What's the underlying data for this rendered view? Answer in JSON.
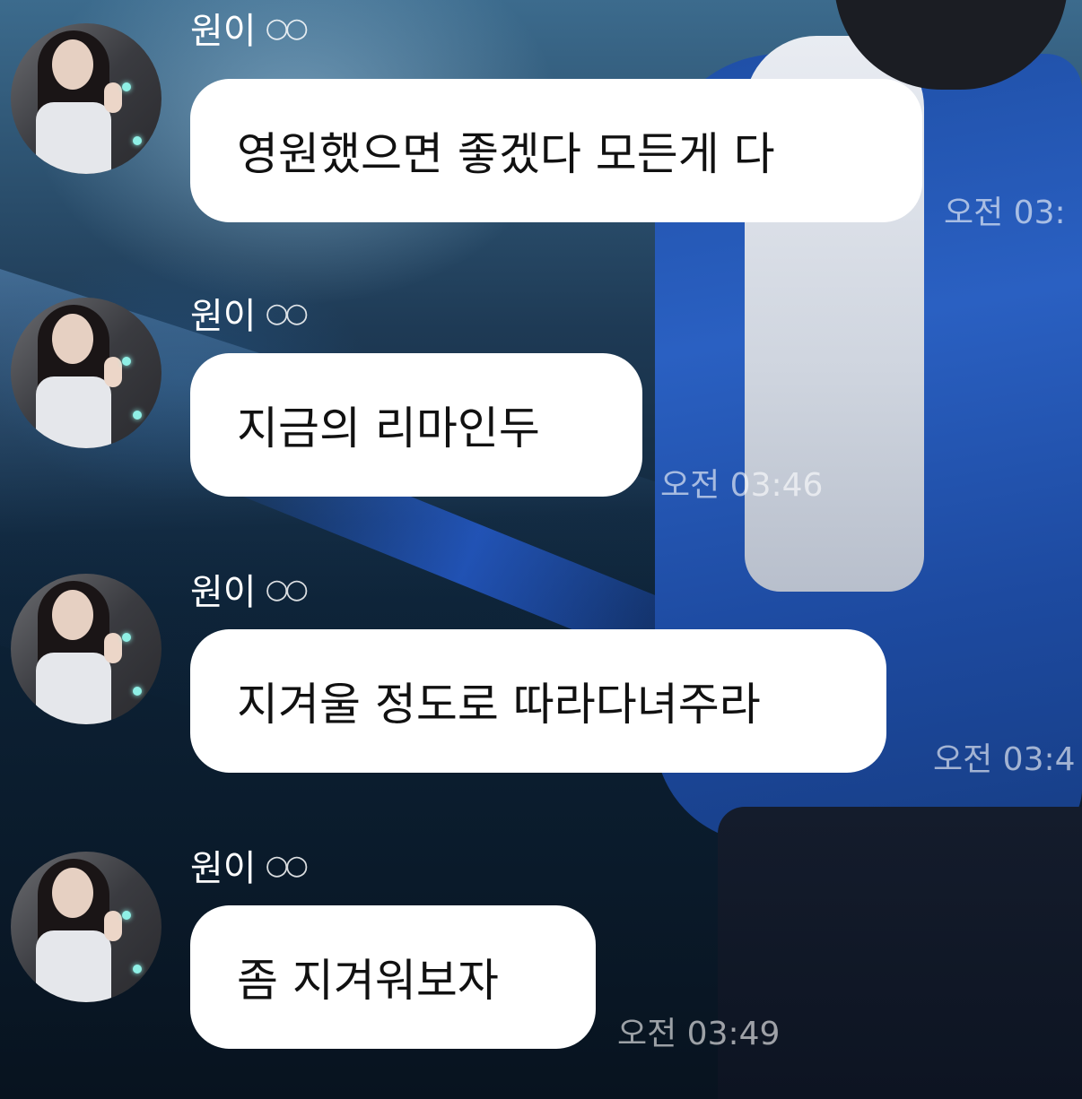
{
  "messages": [
    {
      "sender": "원이",
      "text": "영원했으면 좋겠다 모든게 다",
      "time": "오전 03:"
    },
    {
      "sender": "원이",
      "text": "지금의 리마인두",
      "time": "오전 03:46"
    },
    {
      "sender": "원이",
      "text": "지겨울 정도로 따라다녀주라",
      "time": "오전 03:4"
    },
    {
      "sender": "원이",
      "text": "좀 지겨워보자",
      "time": "오전 03:49"
    }
  ],
  "icons": {
    "sender_badge": "glasses-icon"
  }
}
